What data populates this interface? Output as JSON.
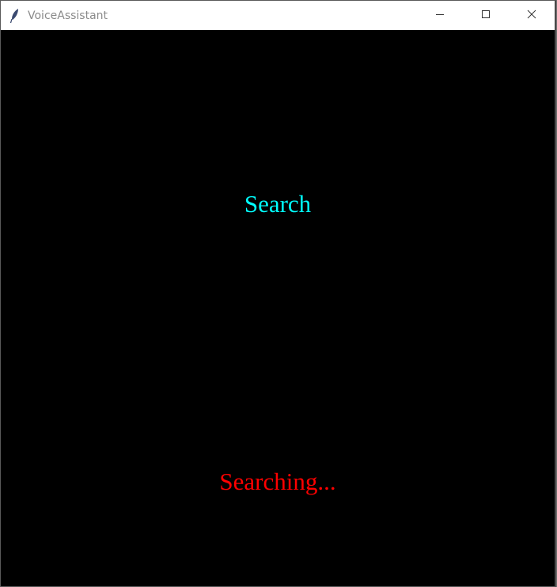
{
  "window": {
    "title": "VoiceAssistant"
  },
  "icons": {
    "app": "feather-icon",
    "minimize": "minimize-icon",
    "maximize": "maximize-icon",
    "close": "close-icon"
  },
  "main": {
    "search_label": "Search",
    "status_text": "Searching..."
  },
  "colors": {
    "background": "#000000",
    "search_label": "#00ffff",
    "status_text": "#ff0000",
    "titlebar": "#ffffff",
    "title_text": "#8a8a8a"
  }
}
